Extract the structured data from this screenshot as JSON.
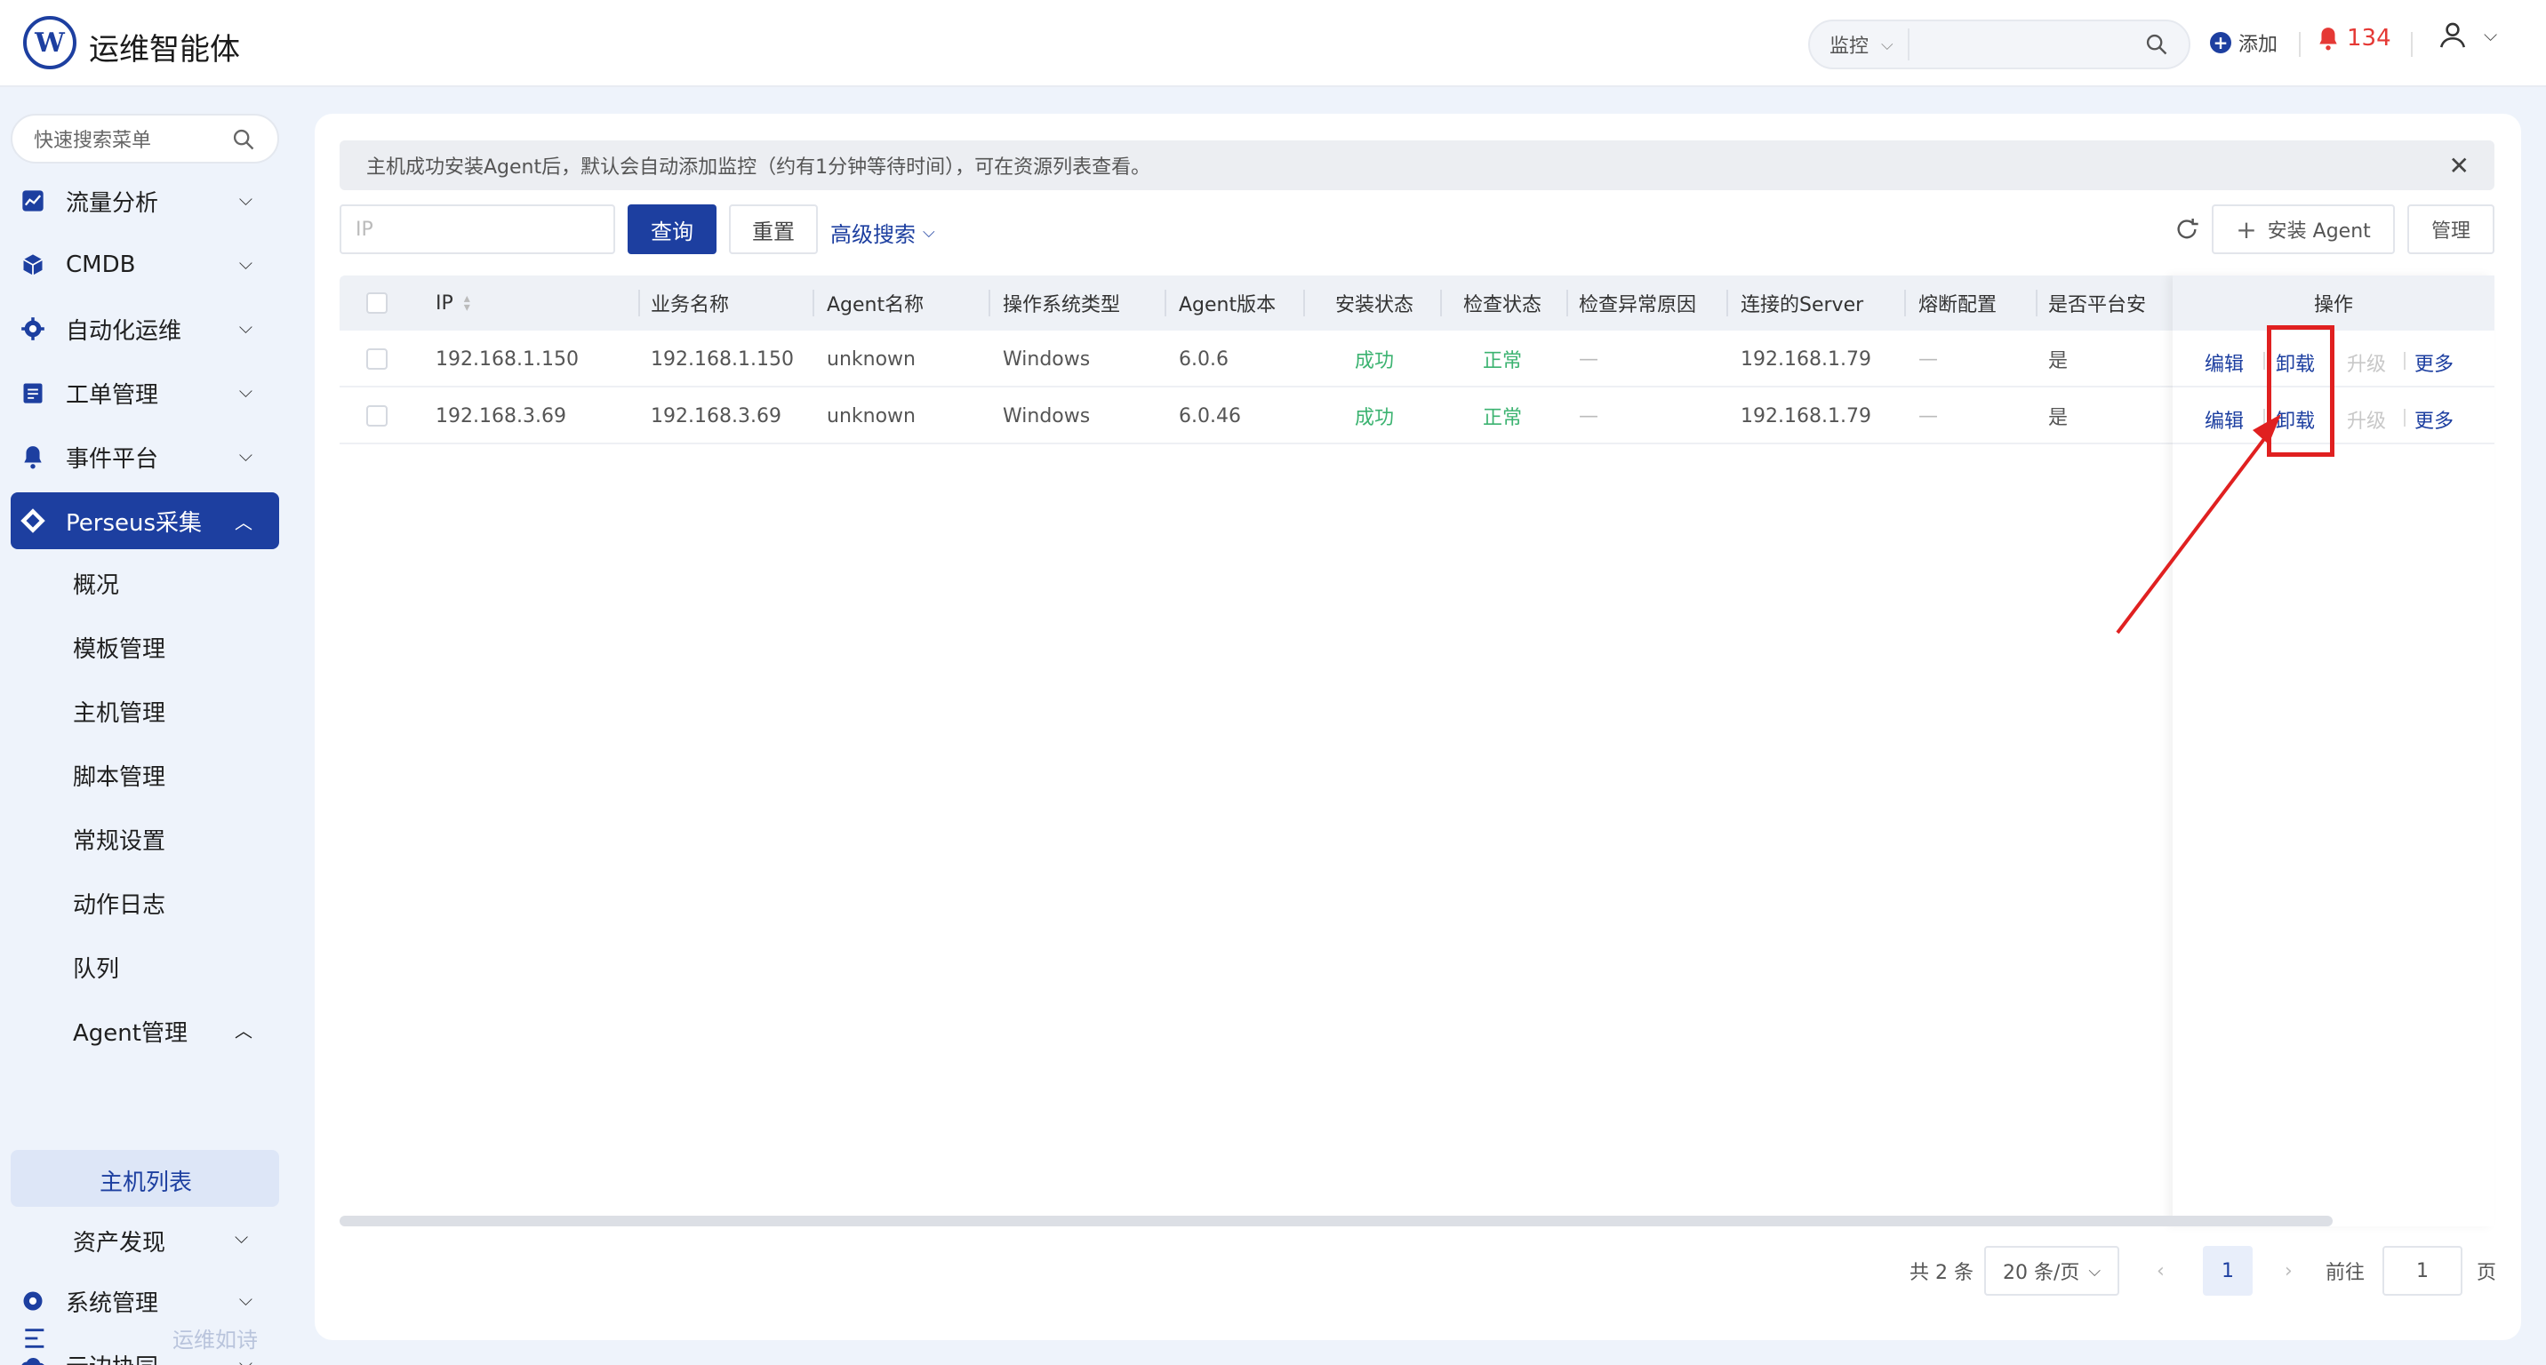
{
  "app": {
    "title": "运维智能体",
    "logo_letter": "W"
  },
  "header": {
    "search_scope": "监控",
    "search_placeholder": "",
    "add_label": "添加",
    "alert_count": "134"
  },
  "sidebar": {
    "search_placeholder": "快速搜索菜单",
    "items": [
      {
        "label": "流量分析",
        "icon": "chart-icon"
      },
      {
        "label": "CMDB",
        "icon": "cube-icon"
      },
      {
        "label": "自动化运维",
        "icon": "gear-icon"
      },
      {
        "label": "工单管理",
        "icon": "ticket-icon"
      },
      {
        "label": "事件平台",
        "icon": "bell-icon"
      },
      {
        "label": "Perseus采集",
        "icon": "diamond-icon"
      }
    ],
    "sub_items": [
      "概况",
      "模板管理",
      "主机管理",
      "脚本管理",
      "常规设置",
      "动作日志",
      "队列",
      "Agent管理"
    ],
    "active_sub": "主机列表",
    "after_items": [
      "资产发现"
    ],
    "bottom_items": [
      {
        "label": "系统管理",
        "icon": "settings-icon"
      },
      {
        "label": "云边协同",
        "icon": "cloud-icon"
      }
    ],
    "footer_text": "运维如诗"
  },
  "notice": {
    "text": "主机成功安装Agent后，默认会自动添加监控（约有1分钟等待时间），可在资源列表查看。"
  },
  "toolbar": {
    "ip_placeholder": "IP",
    "query_label": "查询",
    "reset_label": "重置",
    "advanced_label": "高级搜索",
    "install_label": "安装 Agent",
    "manage_label": "管理"
  },
  "table": {
    "columns": [
      "IP",
      "业务名称",
      "Agent名称",
      "操作系统类型",
      "Agent版本",
      "安装状态",
      "检查状态",
      "检查异常原因",
      "连接的Server",
      "熔断配置",
      "是否平台安",
      "操作"
    ],
    "rows": [
      {
        "ip": "192.168.1.150",
        "biz": "192.168.1.150",
        "agent": "unknown",
        "os": "Windows",
        "ver": "6.0.6",
        "install": "成功",
        "check": "正常",
        "reason": "—",
        "server": "192.168.1.79",
        "fuse": "—",
        "platform": "是"
      },
      {
        "ip": "192.168.3.69",
        "biz": "192.168.3.69",
        "agent": "unknown",
        "os": "Windows",
        "ver": "6.0.46",
        "install": "成功",
        "check": "正常",
        "reason": "—",
        "server": "192.168.1.79",
        "fuse": "—",
        "platform": "是"
      }
    ],
    "ops": {
      "edit": "编辑",
      "uninstall": "卸载",
      "upgrade": "升级",
      "more": "更多"
    }
  },
  "pagination": {
    "total": "共 2 条",
    "page_size": "20 条/页",
    "current": "1",
    "goto_label": "前往",
    "goto_value": "1",
    "page_suffix": "页"
  },
  "colors": {
    "primary": "#1d3fa0",
    "success": "#3cb371",
    "alert": "#e53935",
    "annotation": "#e02020"
  }
}
